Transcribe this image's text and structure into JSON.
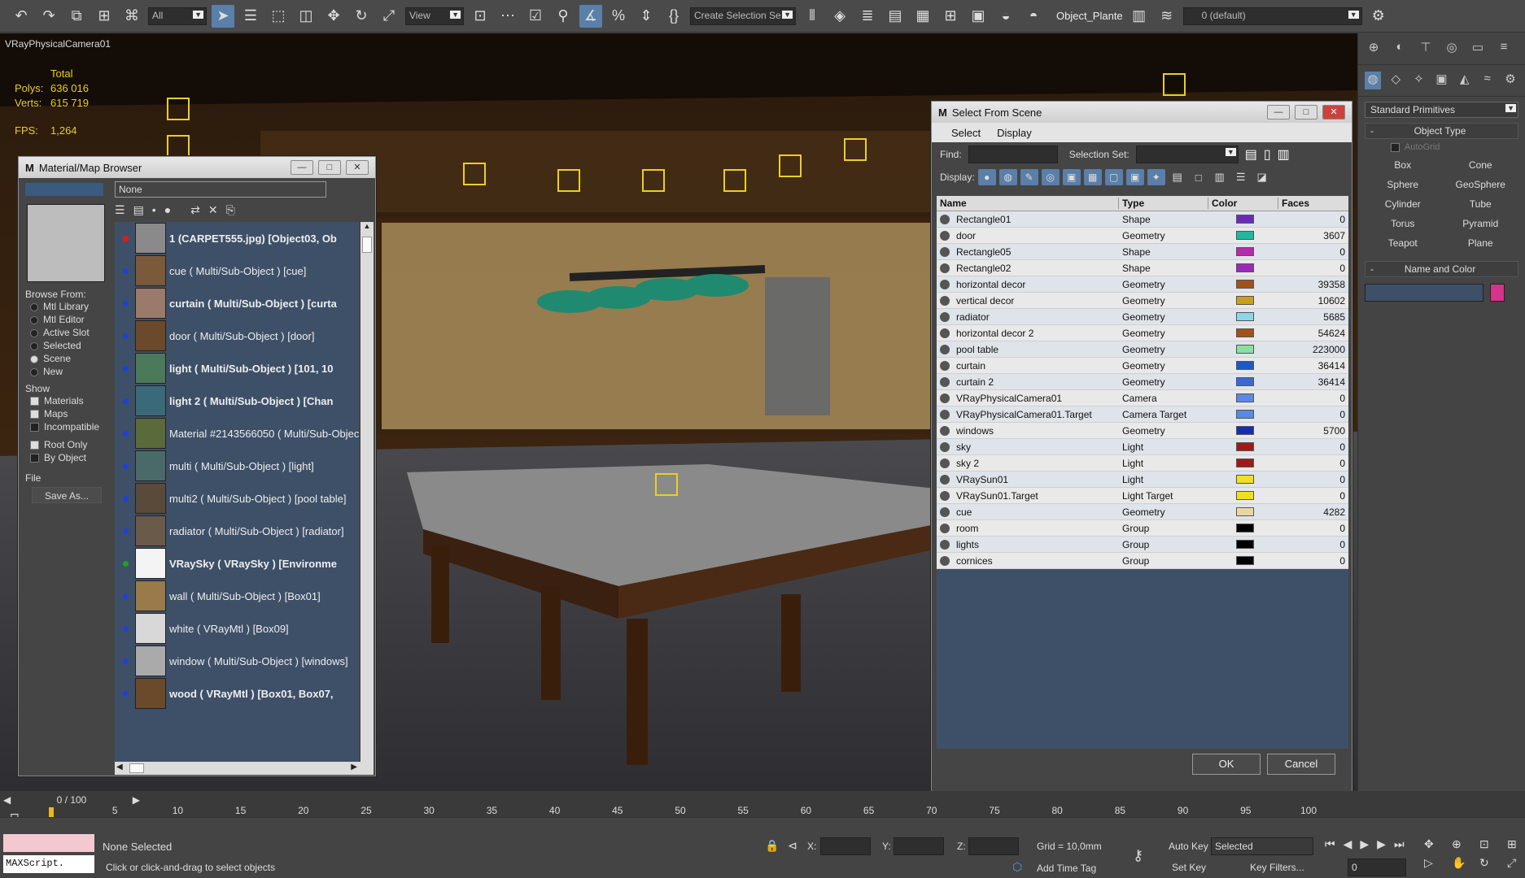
{
  "toolbar": {
    "filter_value": "All",
    "view_value": "View",
    "selection_set_placeholder": "Create Selection Se",
    "object_label": "Object_Plante",
    "layer_value": "0 (default)"
  },
  "viewport": {
    "label": "VRayPhysicalCamera01",
    "stats_header": "Total",
    "polys_label": "Polys:",
    "polys_value": "636 016",
    "verts_label": "Verts:",
    "verts_value": "615 719",
    "fps_label": "FPS:",
    "fps_value": "1,264"
  },
  "material_browser": {
    "title": "Material/Map Browser",
    "name_field": "None",
    "browse_from_label": "Browse From:",
    "browse_options": [
      {
        "label": "Mtl Library",
        "selected": false
      },
      {
        "label": "Mtl Editor",
        "selected": false
      },
      {
        "label": "Active Slot",
        "selected": false
      },
      {
        "label": "Selected",
        "selected": false
      },
      {
        "label": "Scene",
        "selected": true
      },
      {
        "label": "New",
        "selected": false
      }
    ],
    "show_label": "Show",
    "show_options": [
      {
        "label": "Materials",
        "checked": true
      },
      {
        "label": "Maps",
        "checked": true
      },
      {
        "label": "Incompatible",
        "checked": false
      }
    ],
    "root_options": [
      {
        "label": "Root Only",
        "checked": true
      },
      {
        "label": "By Object",
        "checked": false
      }
    ],
    "file_label": "File",
    "save_as_label": "Save As...",
    "items": [
      {
        "label": "1 (CARPET555.jpg)  [Object03, Ob",
        "bold": true,
        "marker": "#d02020",
        "thumb": "#8a8a8a"
      },
      {
        "label": "cue  ( Multi/Sub-Object )  [cue]",
        "bold": false,
        "marker": "#2040d0",
        "thumb": "#7a5a3a"
      },
      {
        "label": "curtain  ( Multi/Sub-Object )  [curta",
        "bold": true,
        "marker": "#2040d0",
        "thumb": "#9a7a6a"
      },
      {
        "label": "door  ( Multi/Sub-Object )  [door]",
        "bold": false,
        "marker": "#2040d0",
        "thumb": "#6a4a2a"
      },
      {
        "label": "light  ( Multi/Sub-Object )  [101, 10",
        "bold": true,
        "marker": "#2040d0",
        "thumb": "#4a7a5a"
      },
      {
        "label": "light 2  ( Multi/Sub-Object )  [Chan",
        "bold": true,
        "marker": "#2040d0",
        "thumb": "#3a6a7a"
      },
      {
        "label": "Material #2143566050  ( Multi/Sub-Objec",
        "bold": false,
        "marker": "#2040d0",
        "thumb": "#5a6a3a"
      },
      {
        "label": "multi  ( Multi/Sub-Object )  [light]",
        "bold": false,
        "marker": "#2040d0",
        "thumb": "#4a6a6a"
      },
      {
        "label": "multi2  ( Multi/Sub-Object )  [pool table]",
        "bold": false,
        "marker": "#2040d0",
        "thumb": "#5a4a3a"
      },
      {
        "label": "radiator  ( Multi/Sub-Object )  [radiator]",
        "bold": false,
        "marker": "#2040d0",
        "thumb": "#6a5a4a"
      },
      {
        "label": "VRaySky  ( VRaySky )  [Environme",
        "bold": true,
        "marker": "#20a020",
        "thumb": "#f4f4f4"
      },
      {
        "label": "wall  ( Multi/Sub-Object )  [Box01]",
        "bold": false,
        "marker": "#2040d0",
        "thumb": "#9a7a4a"
      },
      {
        "label": "white  ( VRayMtl )  [Box09]",
        "bold": false,
        "marker": "#2040d0",
        "thumb": "#d8d8d8"
      },
      {
        "label": "window  ( Multi/Sub-Object )  [windows]",
        "bold": false,
        "marker": "#2040d0",
        "thumb": "#aaaaaa"
      },
      {
        "label": "wood  ( VRayMtl )  [Box01, Box07,",
        "bold": true,
        "marker": "#2040d0",
        "thumb": "#6a4a2a"
      }
    ]
  },
  "select_from_scene": {
    "title": "Select From Scene",
    "menu": [
      "Select",
      "Display"
    ],
    "find_label": "Find:",
    "selection_set_label": "Selection Set:",
    "display_label": "Display:",
    "columns": [
      "Name",
      "Type",
      "Color",
      "Faces"
    ],
    "rows": [
      {
        "name": "Rectangle01",
        "type": "Shape",
        "color": "#6a2bb8",
        "faces": "0"
      },
      {
        "name": "door",
        "type": "Geometry",
        "color": "#1fb8a0",
        "faces": "3607"
      },
      {
        "name": "Rectangle05",
        "type": "Shape",
        "color": "#b82aa8",
        "faces": "0"
      },
      {
        "name": "Rectangle02",
        "type": "Shape",
        "color": "#9a2ab8",
        "faces": "0"
      },
      {
        "name": "horizontal decor",
        "type": "Geometry",
        "color": "#a0521a",
        "faces": "39358"
      },
      {
        "name": "vertical decor",
        "type": "Geometry",
        "color": "#c8a020",
        "faces": "10602"
      },
      {
        "name": "radiator",
        "type": "Geometry",
        "color": "#8ad8e8",
        "faces": "5685"
      },
      {
        "name": "horizontal decor 2",
        "type": "Geometry",
        "color": "#a0521a",
        "faces": "54624"
      },
      {
        "name": "pool table",
        "type": "Geometry",
        "color": "#8ae0a0",
        "faces": "223000"
      },
      {
        "name": "curtain",
        "type": "Geometry",
        "color": "#1a5ac8",
        "faces": "36414"
      },
      {
        "name": "curtain 2",
        "type": "Geometry",
        "color": "#3a6ad0",
        "faces": "36414"
      },
      {
        "name": "VRayPhysicalCamera01",
        "type": "Camera",
        "color": "#5a8ae0",
        "faces": "0"
      },
      {
        "name": "VRayPhysicalCamera01.Target",
        "type": "Camera Target",
        "color": "#5a8ae0",
        "faces": "0"
      },
      {
        "name": "windows",
        "type": "Geometry",
        "color": "#1a2ab8",
        "faces": "5700"
      },
      {
        "name": "sky",
        "type": "Light",
        "color": "#a01a1a",
        "faces": "0"
      },
      {
        "name": "sky 2",
        "type": "Light",
        "color": "#a01a1a",
        "faces": "0"
      },
      {
        "name": "VRaySun01",
        "type": "Light",
        "color": "#f0e020",
        "faces": "0"
      },
      {
        "name": "VRaySun01.Target",
        "type": "Light Target",
        "color": "#f0e020",
        "faces": "0"
      },
      {
        "name": "cue",
        "type": "Geometry",
        "color": "#e8d8a0",
        "faces": "4282"
      },
      {
        "name": "room",
        "type": "Group",
        "color": "#000000",
        "faces": "0"
      },
      {
        "name": "lights",
        "type": "Group",
        "color": "#000000",
        "faces": "0"
      },
      {
        "name": "cornices",
        "type": "Group",
        "color": "#000000",
        "faces": "0"
      }
    ],
    "ok_label": "OK",
    "cancel_label": "Cancel"
  },
  "command_panel": {
    "dropdown": "Standard Primitives",
    "object_type_label": "Object Type",
    "autogrid_label": "AutoGrid",
    "buttons": [
      "Box",
      "Cone",
      "Sphere",
      "GeoSphere",
      "Cylinder",
      "Tube",
      "Torus",
      "Pyramid",
      "Teapot",
      "Plane"
    ],
    "name_color_label": "Name and Color",
    "swatch_color": "#d4348a"
  },
  "timeline": {
    "frame_counter": "0 / 100",
    "ticks": [
      "5",
      "10",
      "15",
      "20",
      "25",
      "30",
      "35",
      "40",
      "45",
      "50",
      "55",
      "60",
      "65",
      "70",
      "75",
      "80",
      "85",
      "90",
      "95",
      "100"
    ]
  },
  "status": {
    "maxscript": "MAXScript.",
    "selection_state": "None Selected",
    "prompt": "Click or click-and-drag to select objects",
    "x_label": "X:",
    "y_label": "Y:",
    "z_label": "Z:",
    "grid": "Grid = 10,0mm",
    "add_time_tag": "Add Time Tag",
    "auto_key": "Auto Key",
    "set_key": "Set Key",
    "key_mode": "Selected",
    "key_filters": "Key Filters...",
    "current_frame": "0"
  }
}
